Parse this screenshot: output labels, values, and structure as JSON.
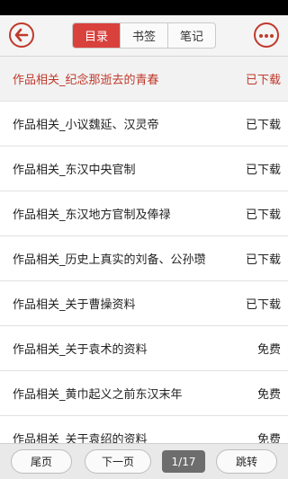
{
  "colors": {
    "accent": "#c0392b",
    "tab_active": "#d9413c"
  },
  "header": {
    "back_icon": "back-arrow-icon",
    "more_icon": "more-ellipsis-icon",
    "tabs": [
      {
        "label": "目录",
        "active": true
      },
      {
        "label": "书签",
        "active": false
      },
      {
        "label": "笔记",
        "active": false
      }
    ]
  },
  "chapters": [
    {
      "title": "作品相关_纪念那逝去的青春",
      "status": "已下载",
      "current": true
    },
    {
      "title": "作品相关_小议魏延、汉灵帝",
      "status": "已下载",
      "current": false
    },
    {
      "title": "作品相关_东汉中央官制",
      "status": "已下载",
      "current": false
    },
    {
      "title": "作品相关_东汉地方官制及俸禄",
      "status": "已下载",
      "current": false
    },
    {
      "title": "作品相关_历史上真实的刘备、公孙瓒",
      "status": "已下载",
      "current": false
    },
    {
      "title": "作品相关_关于曹操资料",
      "status": "已下载",
      "current": false
    },
    {
      "title": "作品相关_关于袁术的资料",
      "status": "免费",
      "current": false
    },
    {
      "title": "作品相关_黄巾起义之前东汉末年",
      "status": "免费",
      "current": false
    },
    {
      "title": "作品相关_关于袁绍的资料",
      "status": "免费",
      "current": false
    }
  ],
  "footer": {
    "last_page": "尾页",
    "next_page": "下一页",
    "page_indicator": "1/17",
    "jump": "跳转"
  }
}
